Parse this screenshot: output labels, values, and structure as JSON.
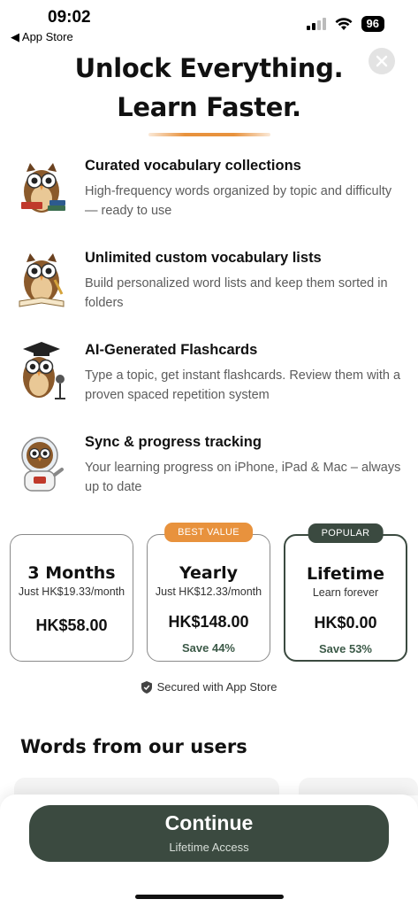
{
  "status_bar": {
    "time": "09:02",
    "back_label": "◀ App Store",
    "battery": "96",
    "icons": [
      "signal-icon",
      "wifi-icon",
      "battery-icon"
    ]
  },
  "header": {
    "title_line1": "Unlock Everything.",
    "title_line2": "Learn Faster.",
    "accent_color": "#e8923d"
  },
  "features": [
    {
      "title": "Curated vocabulary collections",
      "desc": "High-frequency words organized by topic and difficulty — ready to use",
      "icon": "owl-reading-icon"
    },
    {
      "title": "Unlimited custom vocabulary lists",
      "desc": "Build personalized word lists and keep them sorted in folders",
      "icon": "owl-writing-icon"
    },
    {
      "title": "AI-Generated Flashcards",
      "desc": "Type a topic, get instant flashcards. Review them with a proven spaced repetition system",
      "icon": "owl-graduate-icon"
    },
    {
      "title": "Sync & progress tracking",
      "desc": "Your learning progress on iPhone, iPad & Mac – always up to date",
      "icon": "owl-astronaut-icon"
    }
  ],
  "plans": [
    {
      "name": "3 Months",
      "sub": "Just HK$19.33/month",
      "price": "HK$58.00",
      "save": "",
      "badge": ""
    },
    {
      "name": "Yearly",
      "sub": "Just HK$12.33/month",
      "price": "HK$148.00",
      "save": "Save 44%",
      "badge": "BEST VALUE"
    },
    {
      "name": "Lifetime",
      "sub": "Learn forever",
      "price": "HK$0.00",
      "save": "Save 53%",
      "badge": "POPULAR"
    }
  ],
  "secured_text": "Secured with App Store",
  "reviews_title": "Words from our users",
  "cta": {
    "label": "Continue",
    "sublabel": "Lifetime Access",
    "color": "#3b4a40"
  }
}
